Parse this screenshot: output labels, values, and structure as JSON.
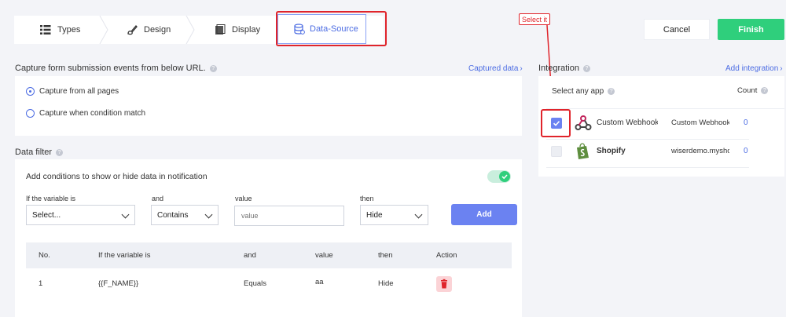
{
  "steps": {
    "types": "Types",
    "design": "Design",
    "display": "Display",
    "data_source": "Data-Source"
  },
  "actions": {
    "cancel": "Cancel",
    "finish": "Finish"
  },
  "annotation": {
    "callout": "Select it"
  },
  "capture": {
    "title": "Capture form submission events from below URL.",
    "captured_link": "Captured data",
    "option_all": "Capture from all pages",
    "option_condition": "Capture when condition match",
    "selected": "option_all"
  },
  "filter": {
    "title": "Data filter",
    "toggle_label": "Add conditions to show or hide data in notification",
    "toggle_on": true,
    "var_label": "If the variable is",
    "and_label": "and",
    "value_label": "value",
    "then_label": "then",
    "var_select": "Select...",
    "and_select": "Contains",
    "value_placeholder": "value",
    "then_select": "Hide",
    "add_button": "Add",
    "table": {
      "headers": [
        "No.",
        "If the variable is",
        "and",
        "value",
        "then",
        "Action"
      ],
      "rows": [
        [
          "1",
          "{{F_NAME}}",
          "Equals",
          "aa",
          "Hide"
        ]
      ]
    }
  },
  "integration": {
    "title": "Integration",
    "add_link": "Add integration",
    "select_label": "Select any app",
    "count_label": "Count",
    "apps": [
      {
        "name": "Custom Webhook",
        "detail": "Custom Webhook",
        "count": "0",
        "checked": true
      },
      {
        "name": "Shopify",
        "detail": "wiserdemo.myshopify",
        "count": "0",
        "checked": false
      }
    ]
  },
  "colors": {
    "accent": "#4d6de3",
    "finish": "#2fcf7c",
    "annotation_red": "#e0242b"
  }
}
